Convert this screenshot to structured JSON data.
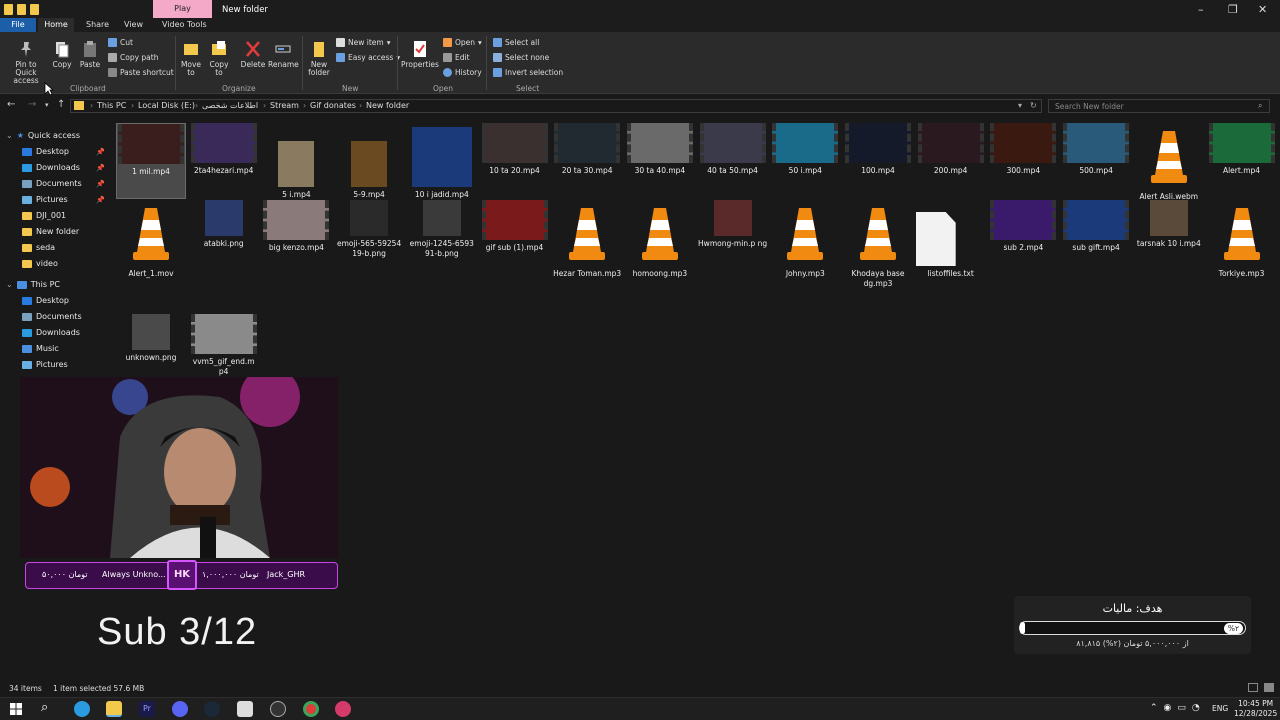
{
  "window": {
    "title": "New folder",
    "play_tab": "Play"
  },
  "menu": {
    "file": "File",
    "home": "Home",
    "share": "Share",
    "view": "View",
    "video_tools": "Video Tools"
  },
  "ribbon": {
    "pin": "Pin to Quick access",
    "copy": "Copy",
    "paste": "Paste",
    "cut": "Cut",
    "copy_path": "Copy path",
    "paste_shortcut": "Paste shortcut",
    "move_to": "Move to",
    "copy_to": "Copy to",
    "delete": "Delete",
    "rename": "Rename",
    "new_folder": "New folder",
    "new_item": "New item",
    "easy_access": "Easy access",
    "properties": "Properties",
    "open": "Open",
    "edit": "Edit",
    "history": "History",
    "select_all": "Select all",
    "select_none": "Select none",
    "invert_selection": "Invert selection",
    "groups": {
      "clipboard": "Clipboard",
      "organize": "Organize",
      "new": "New",
      "open": "Open",
      "select": "Select"
    }
  },
  "address": {
    "crumbs": [
      "This PC",
      "Local Disk (E:)",
      "اطلاعات شخصی",
      "Stream",
      "Gif donates",
      "New folder"
    ],
    "search_placeholder": "Search New folder"
  },
  "nav": {
    "quick_access": "Quick access",
    "quick_items": [
      "Desktop",
      "Downloads",
      "Documents",
      "Pictures",
      "DJI_001",
      "New folder",
      "seda",
      "video"
    ],
    "this_pc": "This PC",
    "pc_items": [
      "Desktop",
      "Documents",
      "Downloads",
      "Music",
      "Pictures"
    ]
  },
  "files": [
    {
      "name": "1 mil.mp4",
      "kind": "video",
      "color": "#3a1e1e"
    },
    {
      "name": "2ta4hezari.mp4",
      "kind": "video",
      "color": "#3a2a5a"
    },
    {
      "name": "5 i.mp4",
      "kind": "img",
      "color": "#8a7a60"
    },
    {
      "name": "5-9.mp4",
      "kind": "img",
      "color": "#6a4a20"
    },
    {
      "name": "10 i jadid.mp4",
      "kind": "img",
      "color": "#1a3a7a"
    },
    {
      "name": "10 ta 20.mp4",
      "kind": "video",
      "color": "#3a3030"
    },
    {
      "name": "20 ta 30.mp4",
      "kind": "video",
      "color": "#202a30"
    },
    {
      "name": "30 ta 40.mp4",
      "kind": "video",
      "color": "#6a6a6a"
    },
    {
      "name": "40 ta 50.mp4",
      "kind": "video",
      "color": "#3a3a4a"
    },
    {
      "name": "50 i.mp4",
      "kind": "video",
      "color": "#1a6a8a"
    },
    {
      "name": "100.mp4",
      "kind": "video",
      "color": "#151a2a"
    },
    {
      "name": "200.mp4",
      "kind": "video",
      "color": "#2a1a20"
    },
    {
      "name": "300.mp4",
      "kind": "video",
      "color": "#3a1a10"
    },
    {
      "name": "500.mp4",
      "kind": "video",
      "color": "#2a5a7a"
    },
    {
      "name": "Alert Asli.webm",
      "kind": "cone"
    },
    {
      "name": "Alert.mp4",
      "kind": "video",
      "color": "#1a6a3a"
    },
    {
      "name": "Alert_1.mov",
      "kind": "cone"
    },
    {
      "name": "atabki.png",
      "kind": "img",
      "color": "#2a3a6a"
    },
    {
      "name": "big kenzo.mp4",
      "kind": "video",
      "color": "#8a7a7a"
    },
    {
      "name": "emoji-565-59254 19-b.png",
      "kind": "img",
      "color": "#2a2a2a"
    },
    {
      "name": "emoji-1245-6593 91-b.png",
      "kind": "img",
      "color": "#3a3a3a"
    },
    {
      "name": "gif sub (1).mp4",
      "kind": "video",
      "color": "#7a1a1a"
    },
    {
      "name": "Hezar Toman.mp3",
      "kind": "cone"
    },
    {
      "name": "homoong.mp3",
      "kind": "cone"
    },
    {
      "name": "Hwmong-min.p ng",
      "kind": "img",
      "color": "#5a2a2a"
    },
    {
      "name": "Johny.mp3",
      "kind": "cone"
    },
    {
      "name": "Khodaya base dg.mp3",
      "kind": "cone"
    },
    {
      "name": "listoffiles.txt",
      "kind": "doc"
    },
    {
      "name": "sub 2.mp4",
      "kind": "video",
      "color": "#3a1a6a"
    },
    {
      "name": "sub gift.mp4",
      "kind": "video",
      "color": "#1a3a7a"
    },
    {
      "name": "tarsnak 10 i.mp4",
      "kind": "img",
      "color": "#5a4a3a"
    },
    {
      "name": "Torkiye.mp3",
      "kind": "cone"
    },
    {
      "name": "unknown.png",
      "kind": "img",
      "color": "#4a4a4a"
    },
    {
      "name": "vvm5_gif_end.m p4",
      "kind": "video",
      "color": "#8a8a8a"
    }
  ],
  "overlay": {
    "banner_left": "۵۰,۰۰۰ تومان",
    "banner_left_name": "Always Unkno...",
    "banner_right": "۱,۰۰۰,۰۰۰ تومان",
    "banner_right_name": "Jack_GHR",
    "badge": "HK",
    "sub_text": "Sub 3/12",
    "goal_title": "هدف: مالیات",
    "goal_pct": "%۲",
    "goal_progress": 0.02,
    "goal_sub": "۸۱,۸۱۵ از ۵,۰۰۰,۰۰۰ تومان (۲%)"
  },
  "status": {
    "items": "34 items",
    "selected": "1 item selected  57.6 MB"
  },
  "clock": {
    "time": "10:45 PM",
    "date": "12/28/2025",
    "lang": "ENG"
  }
}
